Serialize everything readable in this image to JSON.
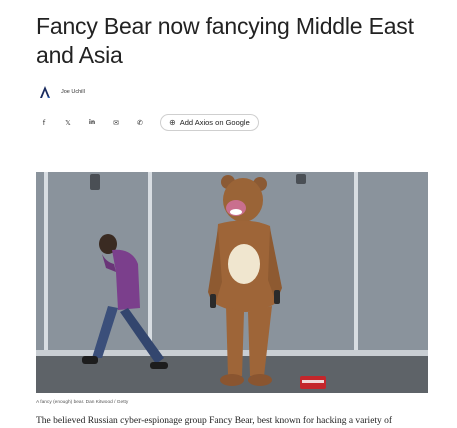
{
  "article": {
    "headline": "Fancy Bear now fancying Middle East and Asia",
    "author": "Joe Uchill",
    "caption": "A fancy (enough) bear. Dan Kitwood / Getty",
    "body_first_line": "The believed Russian cyber-espionage group Fancy Bear, best known for hacking a variety of"
  },
  "share": {
    "buttons": [
      {
        "name": "facebook",
        "glyph": "f"
      },
      {
        "name": "x",
        "glyph": "𝕏"
      },
      {
        "name": "linkedin",
        "glyph": "in"
      },
      {
        "name": "email",
        "glyph": "✉"
      },
      {
        "name": "phone",
        "glyph": "✆"
      }
    ],
    "google_label": "Add Axios on Google"
  },
  "colors": {
    "brand": "#1a2b5e",
    "accent_logo": "#2f6fd6"
  },
  "icons": [
    "axios-logo-icon",
    "facebook-icon",
    "x-icon",
    "linkedin-icon",
    "email-icon",
    "phone-icon",
    "google-add-icon"
  ]
}
